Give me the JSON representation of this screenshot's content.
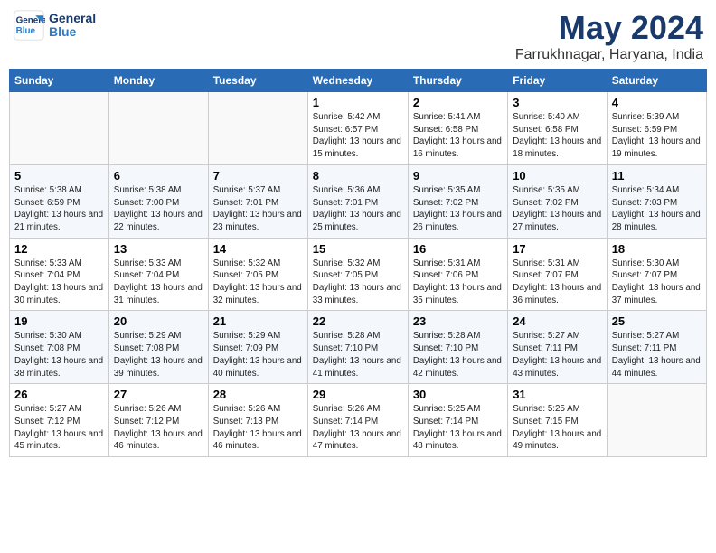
{
  "header": {
    "logo_line1": "General",
    "logo_line2": "Blue",
    "title": "May 2024",
    "subtitle": "Farrukhnagar, Haryana, India"
  },
  "days_of_week": [
    "Sunday",
    "Monday",
    "Tuesday",
    "Wednesday",
    "Thursday",
    "Friday",
    "Saturday"
  ],
  "weeks": [
    [
      {
        "day": "",
        "info": ""
      },
      {
        "day": "",
        "info": ""
      },
      {
        "day": "",
        "info": ""
      },
      {
        "day": "1",
        "info": "Sunrise: 5:42 AM\nSunset: 6:57 PM\nDaylight: 13 hours and 15 minutes."
      },
      {
        "day": "2",
        "info": "Sunrise: 5:41 AM\nSunset: 6:58 PM\nDaylight: 13 hours and 16 minutes."
      },
      {
        "day": "3",
        "info": "Sunrise: 5:40 AM\nSunset: 6:58 PM\nDaylight: 13 hours and 18 minutes."
      },
      {
        "day": "4",
        "info": "Sunrise: 5:39 AM\nSunset: 6:59 PM\nDaylight: 13 hours and 19 minutes."
      }
    ],
    [
      {
        "day": "5",
        "info": "Sunrise: 5:38 AM\nSunset: 6:59 PM\nDaylight: 13 hours and 21 minutes."
      },
      {
        "day": "6",
        "info": "Sunrise: 5:38 AM\nSunset: 7:00 PM\nDaylight: 13 hours and 22 minutes."
      },
      {
        "day": "7",
        "info": "Sunrise: 5:37 AM\nSunset: 7:01 PM\nDaylight: 13 hours and 23 minutes."
      },
      {
        "day": "8",
        "info": "Sunrise: 5:36 AM\nSunset: 7:01 PM\nDaylight: 13 hours and 25 minutes."
      },
      {
        "day": "9",
        "info": "Sunrise: 5:35 AM\nSunset: 7:02 PM\nDaylight: 13 hours and 26 minutes."
      },
      {
        "day": "10",
        "info": "Sunrise: 5:35 AM\nSunset: 7:02 PM\nDaylight: 13 hours and 27 minutes."
      },
      {
        "day": "11",
        "info": "Sunrise: 5:34 AM\nSunset: 7:03 PM\nDaylight: 13 hours and 28 minutes."
      }
    ],
    [
      {
        "day": "12",
        "info": "Sunrise: 5:33 AM\nSunset: 7:04 PM\nDaylight: 13 hours and 30 minutes."
      },
      {
        "day": "13",
        "info": "Sunrise: 5:33 AM\nSunset: 7:04 PM\nDaylight: 13 hours and 31 minutes."
      },
      {
        "day": "14",
        "info": "Sunrise: 5:32 AM\nSunset: 7:05 PM\nDaylight: 13 hours and 32 minutes."
      },
      {
        "day": "15",
        "info": "Sunrise: 5:32 AM\nSunset: 7:05 PM\nDaylight: 13 hours and 33 minutes."
      },
      {
        "day": "16",
        "info": "Sunrise: 5:31 AM\nSunset: 7:06 PM\nDaylight: 13 hours and 35 minutes."
      },
      {
        "day": "17",
        "info": "Sunrise: 5:31 AM\nSunset: 7:07 PM\nDaylight: 13 hours and 36 minutes."
      },
      {
        "day": "18",
        "info": "Sunrise: 5:30 AM\nSunset: 7:07 PM\nDaylight: 13 hours and 37 minutes."
      }
    ],
    [
      {
        "day": "19",
        "info": "Sunrise: 5:30 AM\nSunset: 7:08 PM\nDaylight: 13 hours and 38 minutes."
      },
      {
        "day": "20",
        "info": "Sunrise: 5:29 AM\nSunset: 7:08 PM\nDaylight: 13 hours and 39 minutes."
      },
      {
        "day": "21",
        "info": "Sunrise: 5:29 AM\nSunset: 7:09 PM\nDaylight: 13 hours and 40 minutes."
      },
      {
        "day": "22",
        "info": "Sunrise: 5:28 AM\nSunset: 7:10 PM\nDaylight: 13 hours and 41 minutes."
      },
      {
        "day": "23",
        "info": "Sunrise: 5:28 AM\nSunset: 7:10 PM\nDaylight: 13 hours and 42 minutes."
      },
      {
        "day": "24",
        "info": "Sunrise: 5:27 AM\nSunset: 7:11 PM\nDaylight: 13 hours and 43 minutes."
      },
      {
        "day": "25",
        "info": "Sunrise: 5:27 AM\nSunset: 7:11 PM\nDaylight: 13 hours and 44 minutes."
      }
    ],
    [
      {
        "day": "26",
        "info": "Sunrise: 5:27 AM\nSunset: 7:12 PM\nDaylight: 13 hours and 45 minutes."
      },
      {
        "day": "27",
        "info": "Sunrise: 5:26 AM\nSunset: 7:12 PM\nDaylight: 13 hours and 46 minutes."
      },
      {
        "day": "28",
        "info": "Sunrise: 5:26 AM\nSunset: 7:13 PM\nDaylight: 13 hours and 46 minutes."
      },
      {
        "day": "29",
        "info": "Sunrise: 5:26 AM\nSunset: 7:14 PM\nDaylight: 13 hours and 47 minutes."
      },
      {
        "day": "30",
        "info": "Sunrise: 5:25 AM\nSunset: 7:14 PM\nDaylight: 13 hours and 48 minutes."
      },
      {
        "day": "31",
        "info": "Sunrise: 5:25 AM\nSunset: 7:15 PM\nDaylight: 13 hours and 49 minutes."
      },
      {
        "day": "",
        "info": ""
      }
    ]
  ]
}
